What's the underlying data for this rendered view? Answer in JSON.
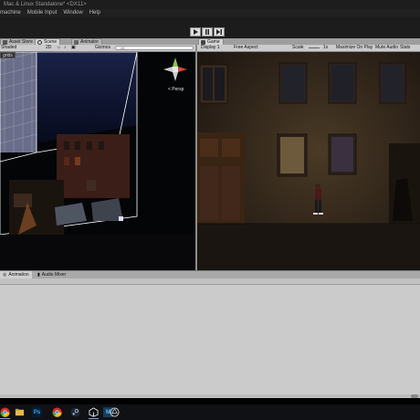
{
  "window": {
    "title": "Mac & Linux Standalone* <DX11>"
  },
  "menu": {
    "items": [
      "machine",
      "Mobile Input",
      "Window",
      "Help"
    ]
  },
  "tabs": {
    "asset_store": "Asset Store",
    "scene": "Scene",
    "animator": "Animator",
    "game": "Game"
  },
  "scene_toolbar": {
    "shading": "Shaded",
    "mode_2d": "2D",
    "gizmos": "Gizmos",
    "search_placeholder": "All",
    "grids": "grids",
    "persp": "< Persp"
  },
  "game_toolbar": {
    "display": "Display 1",
    "aspect": "Free Aspect",
    "scale_label": "Scale",
    "scale_value": "1x",
    "maximize": "Maximize On Play",
    "mute": "Mute Audio",
    "stats": "Stats"
  },
  "bottom_tabs": {
    "animation": "Animation",
    "audio_mixer": "Audio Mixer"
  },
  "taskbar": {
    "icons": [
      "chrome-icon",
      "file-explorer-icon",
      "photoshop-icon",
      "chrome-icon",
      "steam-icon",
      "unity-icon",
      "app-m-icon",
      "unity-hub-icon"
    ]
  },
  "colors": {
    "sky": "#0b1230",
    "building": "#3a2a1a",
    "window_lit": "#7a6a4a"
  }
}
